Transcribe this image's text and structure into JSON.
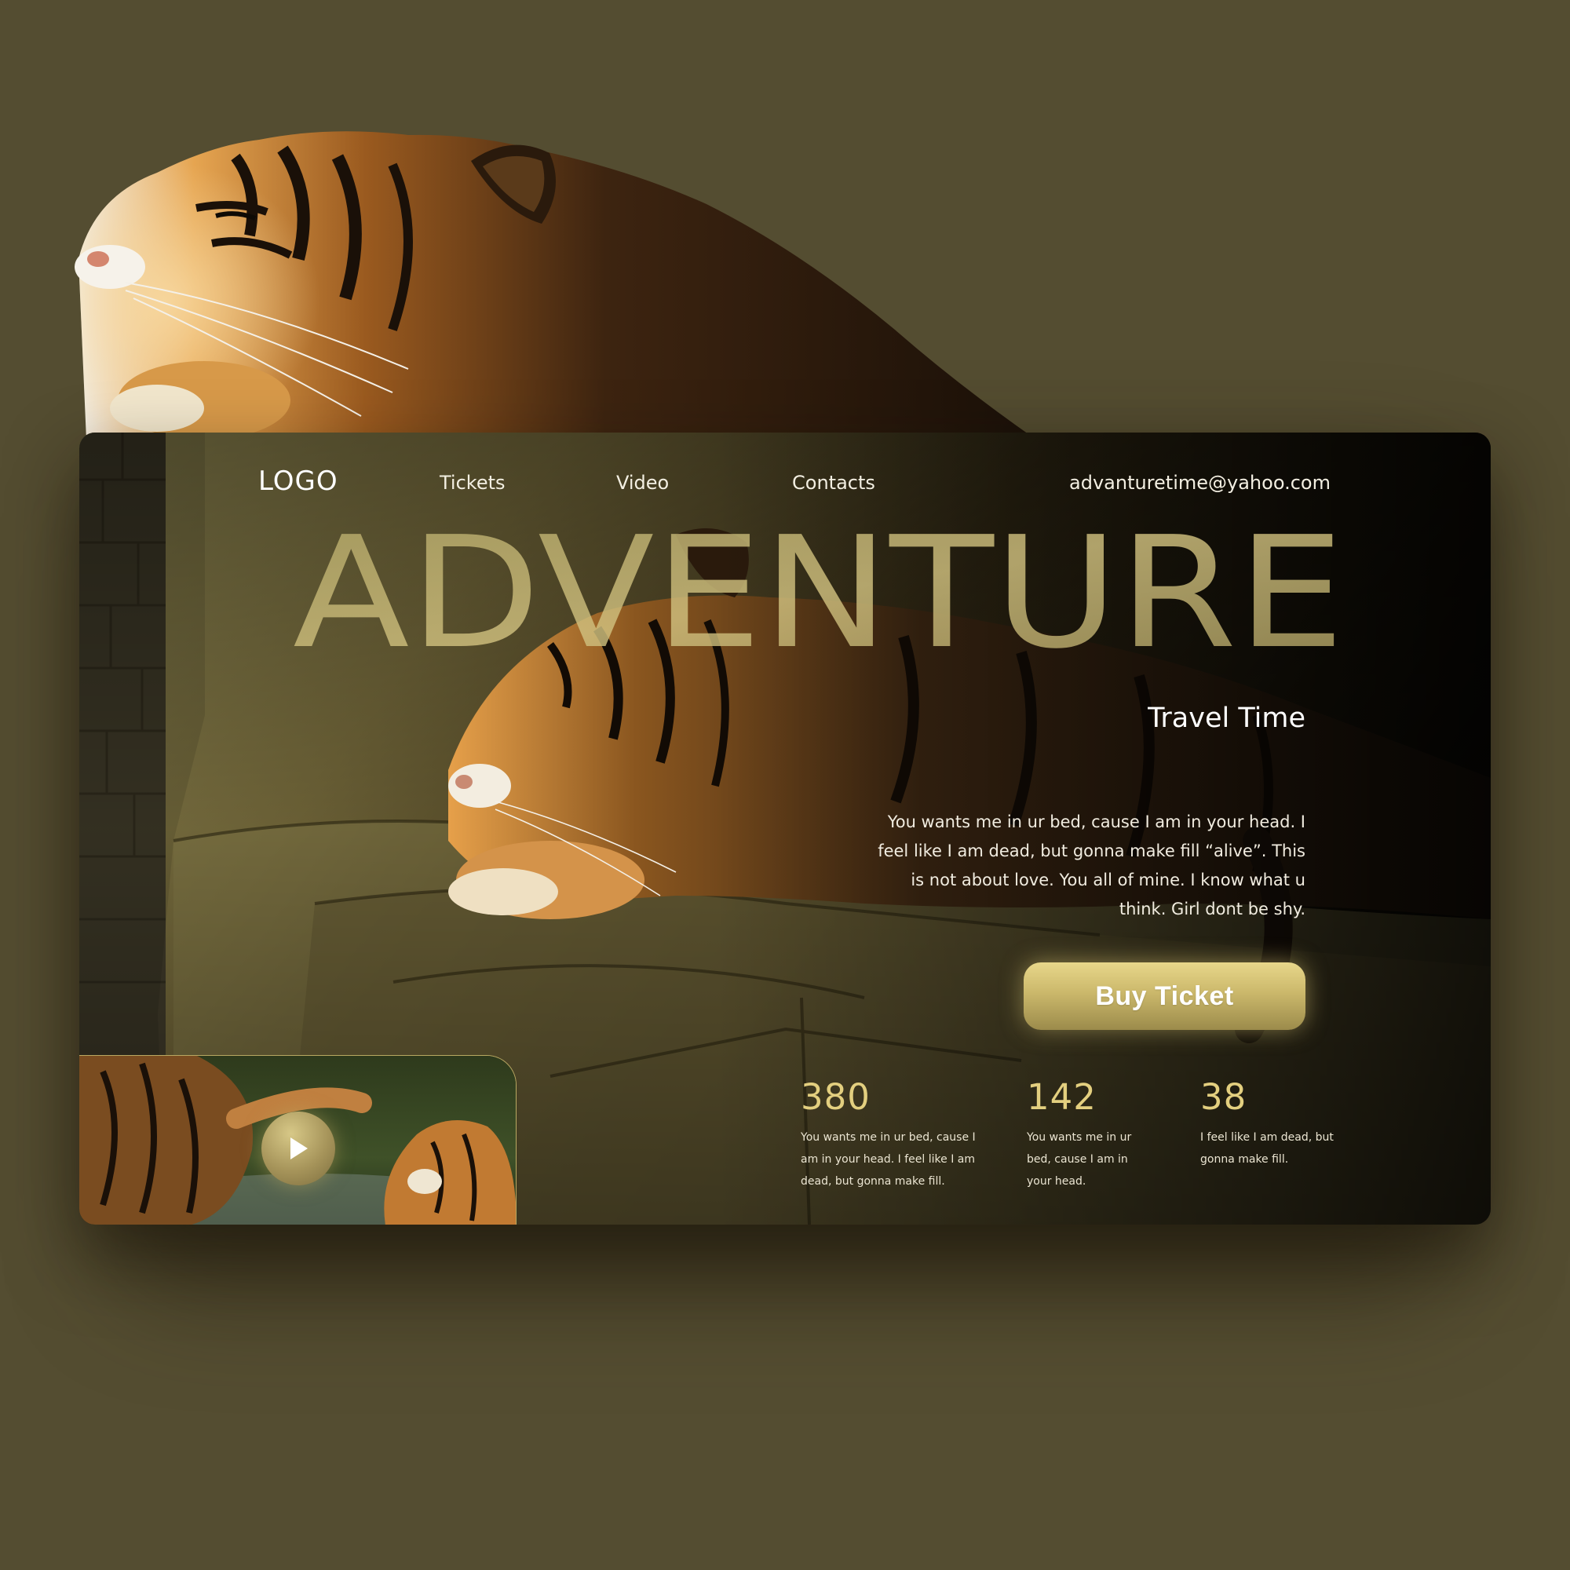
{
  "nav": {
    "logo": "LOGO",
    "links": [
      "Tickets",
      "Video",
      "Contacts"
    ],
    "email": "advanturetime@yahoo.com"
  },
  "hero": {
    "headline": "ADVENTURE",
    "subtitle": "Travel Time",
    "description": "You wants me in ur bed, cause I am in your head. I feel like I am dead, but gonna make fill “alive”. This is not about love. You all of mine. I know what u think. Girl dont be shy.",
    "cta_label": "Buy Ticket"
  },
  "stats": [
    {
      "number": "380",
      "text": "You wants me in ur bed, cause I am in your head. I feel like I am dead, but gonna make fill."
    },
    {
      "number": "142",
      "text": "You wants me in ur bed, cause I am in your head."
    },
    {
      "number": "38",
      "text": "I feel like I am dead, but gonna make fill."
    }
  ],
  "video": {
    "play_icon": "play-icon"
  },
  "colors": {
    "background": "#544d31",
    "accent_gold": "#e3cf7f",
    "button_gold": "#cbb86b",
    "card_dark": "#16120a"
  }
}
